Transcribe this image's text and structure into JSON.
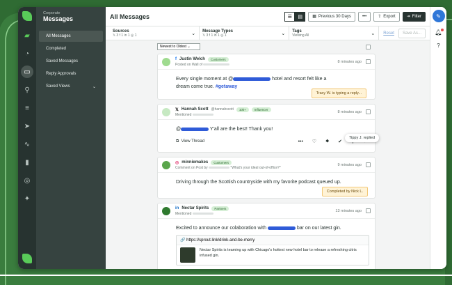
{
  "sidebar": {
    "subtitle": "Corporate",
    "title": "Messages",
    "items": [
      {
        "label": "All Messages"
      },
      {
        "label": "Completed"
      },
      {
        "label": "Saved Messages"
      },
      {
        "label": "Reply Approvals"
      },
      {
        "label": "Saved Views"
      }
    ]
  },
  "header": {
    "title": "All Messages",
    "date_range": "Previous 30 Days",
    "export": "Export",
    "filter": "Filter"
  },
  "filters": {
    "sources_label": "Sources",
    "sources_value": "𝕏 3  f 1  in 1  ◎ 1",
    "types_label": "Message Types",
    "types_value": "𝕏 3  f 1  in 1  ◎ 1",
    "tags_label": "Tags",
    "tags_value": "Viewing All",
    "reset": "Reset",
    "save_as": "Save As..."
  },
  "sort": "Newest to Oldest",
  "messages": [
    {
      "network": "facebook",
      "author": "Justin Welch",
      "badge": "Customers",
      "sub": "Posted on Wall of",
      "time": "8 minutes ago",
      "text_pre": "Every single moment at @",
      "text_post": " hotel and resort felt like a dream come true. ",
      "hashtag": "#getaway",
      "status_note": "Tracy W. is typing a reply..."
    },
    {
      "network": "x",
      "author": "Hannah Scott",
      "handle": "@hannahscott",
      "badge": "10k+",
      "badge2": "Influencer",
      "sub": "Mentioned",
      "time": "8 minutes ago",
      "text_pre": "@",
      "text_post": " Y'all are the best! Thank you!",
      "view_thread": "View Thread",
      "tooltip": "Tippy J. replied"
    },
    {
      "network": "instagram",
      "author": "minniemakes",
      "badge": "Customers",
      "sub": "Comment on Post by",
      "sub2": "\"What's your ideal out-of-office?\"",
      "time": "9 minutes ago",
      "text": "Driving through the Scottish countryside with my favorite podcast queued up.",
      "status_note": "Completed by Nick L."
    },
    {
      "network": "linkedin",
      "author": "Nectar Spirits",
      "badge": "Partners",
      "sub": "Mentioned",
      "time": "13 minutes ago",
      "text_pre": "Excited to announce our colaboration with ",
      "text_post": " bar on our latest gin.",
      "link_url": "https://sprout.link/drink-and-be-merry",
      "link_text": "Nectar Spirits is teaming up with Chicago's hottest new hotel bar to release a refreshing citris infused gin."
    }
  ],
  "colors": {
    "brand_green": "#59cb59",
    "background": "#2f6b33",
    "rail": "#273330",
    "sidebar": "#364340",
    "mask_blue": "#2f5bd8",
    "compose_blue": "#2f77d8"
  }
}
